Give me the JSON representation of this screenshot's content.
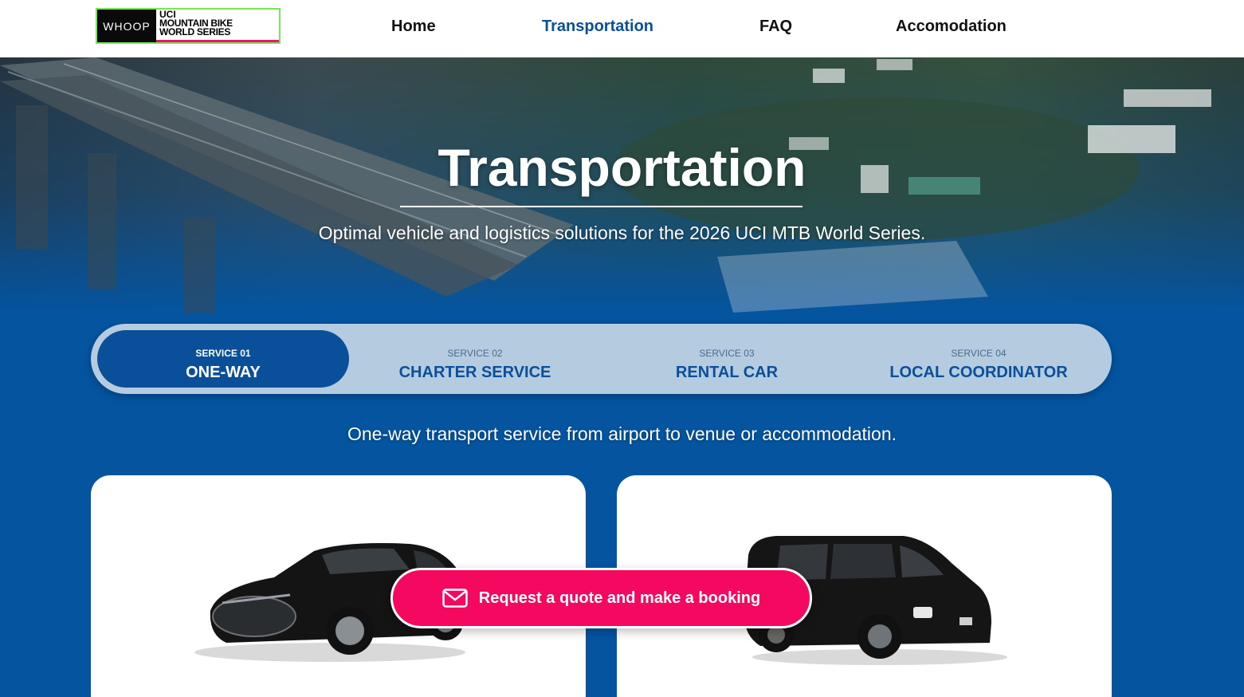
{
  "header": {
    "logo": {
      "whoop": "WHOOP",
      "line1": "UCI",
      "line2": "MOUNTAIN BIKE",
      "line3": "WORLD SERIES"
    },
    "nav": [
      {
        "label": "Home",
        "active": false
      },
      {
        "label": "Transportation",
        "active": true
      },
      {
        "label": "FAQ",
        "active": false
      },
      {
        "label": "Accomodation",
        "active": false
      }
    ]
  },
  "hero": {
    "title": "Transportation",
    "subtitle": "Optimal vehicle and logistics solutions for the 2026 UCI MTB World Series."
  },
  "tabs": [
    {
      "number": "SERVICE 01",
      "name": "ONE-WAY",
      "active": true
    },
    {
      "number": "SERVICE 02",
      "name": "CHARTER SERVICE",
      "active": false
    },
    {
      "number": "SERVICE 03",
      "name": "RENTAL CAR",
      "active": false
    },
    {
      "number": "SERVICE 04",
      "name": "LOCAL COORDINATOR",
      "active": false
    }
  ],
  "service_description": "One-way transport service from airport to venue or accommodation.",
  "cards": [
    {
      "image": "black-sedan"
    },
    {
      "image": "black-van"
    }
  ],
  "cta": {
    "label": "Request a quote and make a booking",
    "icon": "mail-icon"
  },
  "colors": {
    "brand_blue": "#0454a0",
    "accent_pink": "#f5085f",
    "tab_bg": "#b4cbe0",
    "active_tab": "#0a4f99"
  }
}
